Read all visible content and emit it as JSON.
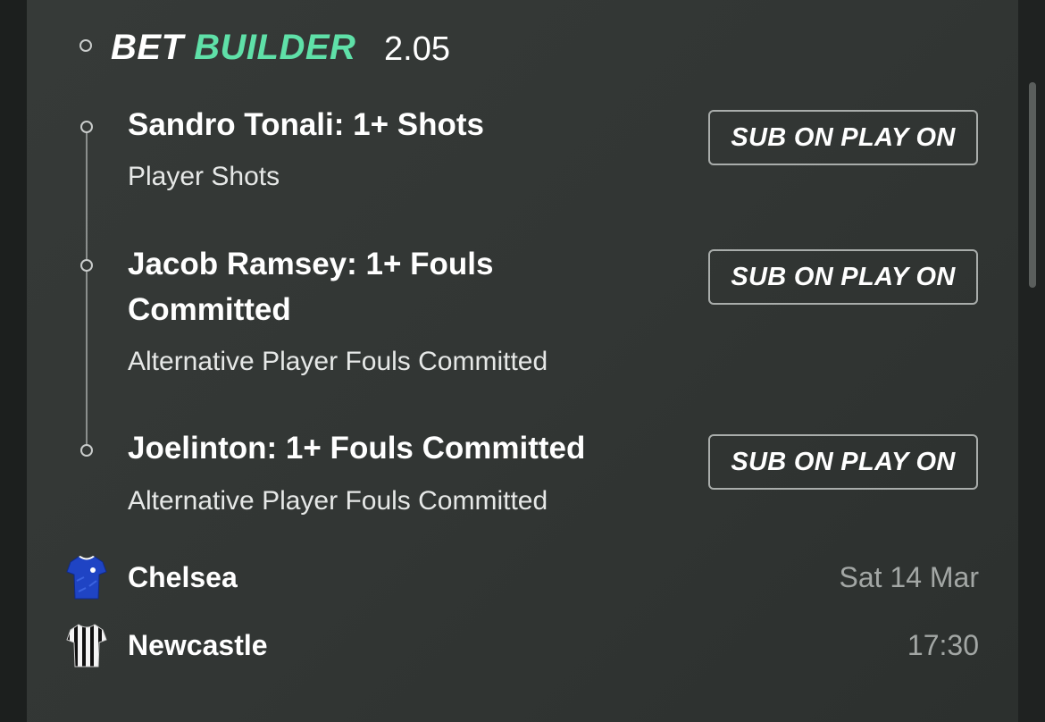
{
  "header": {
    "bet_word": "BET",
    "builder_word": "BUILDER",
    "odds": "2.05",
    "accent_color": "#5fe0a8"
  },
  "selections": [
    {
      "title_line1": "Sandro Tonali: 1+ Shots",
      "title_line2": "",
      "market": "Player Shots",
      "button_label": "SUB ON PLAY ON"
    },
    {
      "title_line1": "Jacob Ramsey: 1+ Fouls",
      "title_line2": "Committed",
      "market": "Alternative Player Fouls Committed",
      "button_label": "SUB ON PLAY ON"
    },
    {
      "title_line1": "Joelinton: 1+ Fouls Committed",
      "title_line2": "",
      "market": "Alternative Player Fouls Committed",
      "button_label": "SUB ON PLAY ON"
    }
  ],
  "match": {
    "home": {
      "name": "Chelsea",
      "meta": "Sat 14 Mar",
      "icon": "chelsea-shirt-icon"
    },
    "away": {
      "name": "Newcastle",
      "meta": "17:30",
      "icon": "newcastle-shirt-icon"
    }
  }
}
